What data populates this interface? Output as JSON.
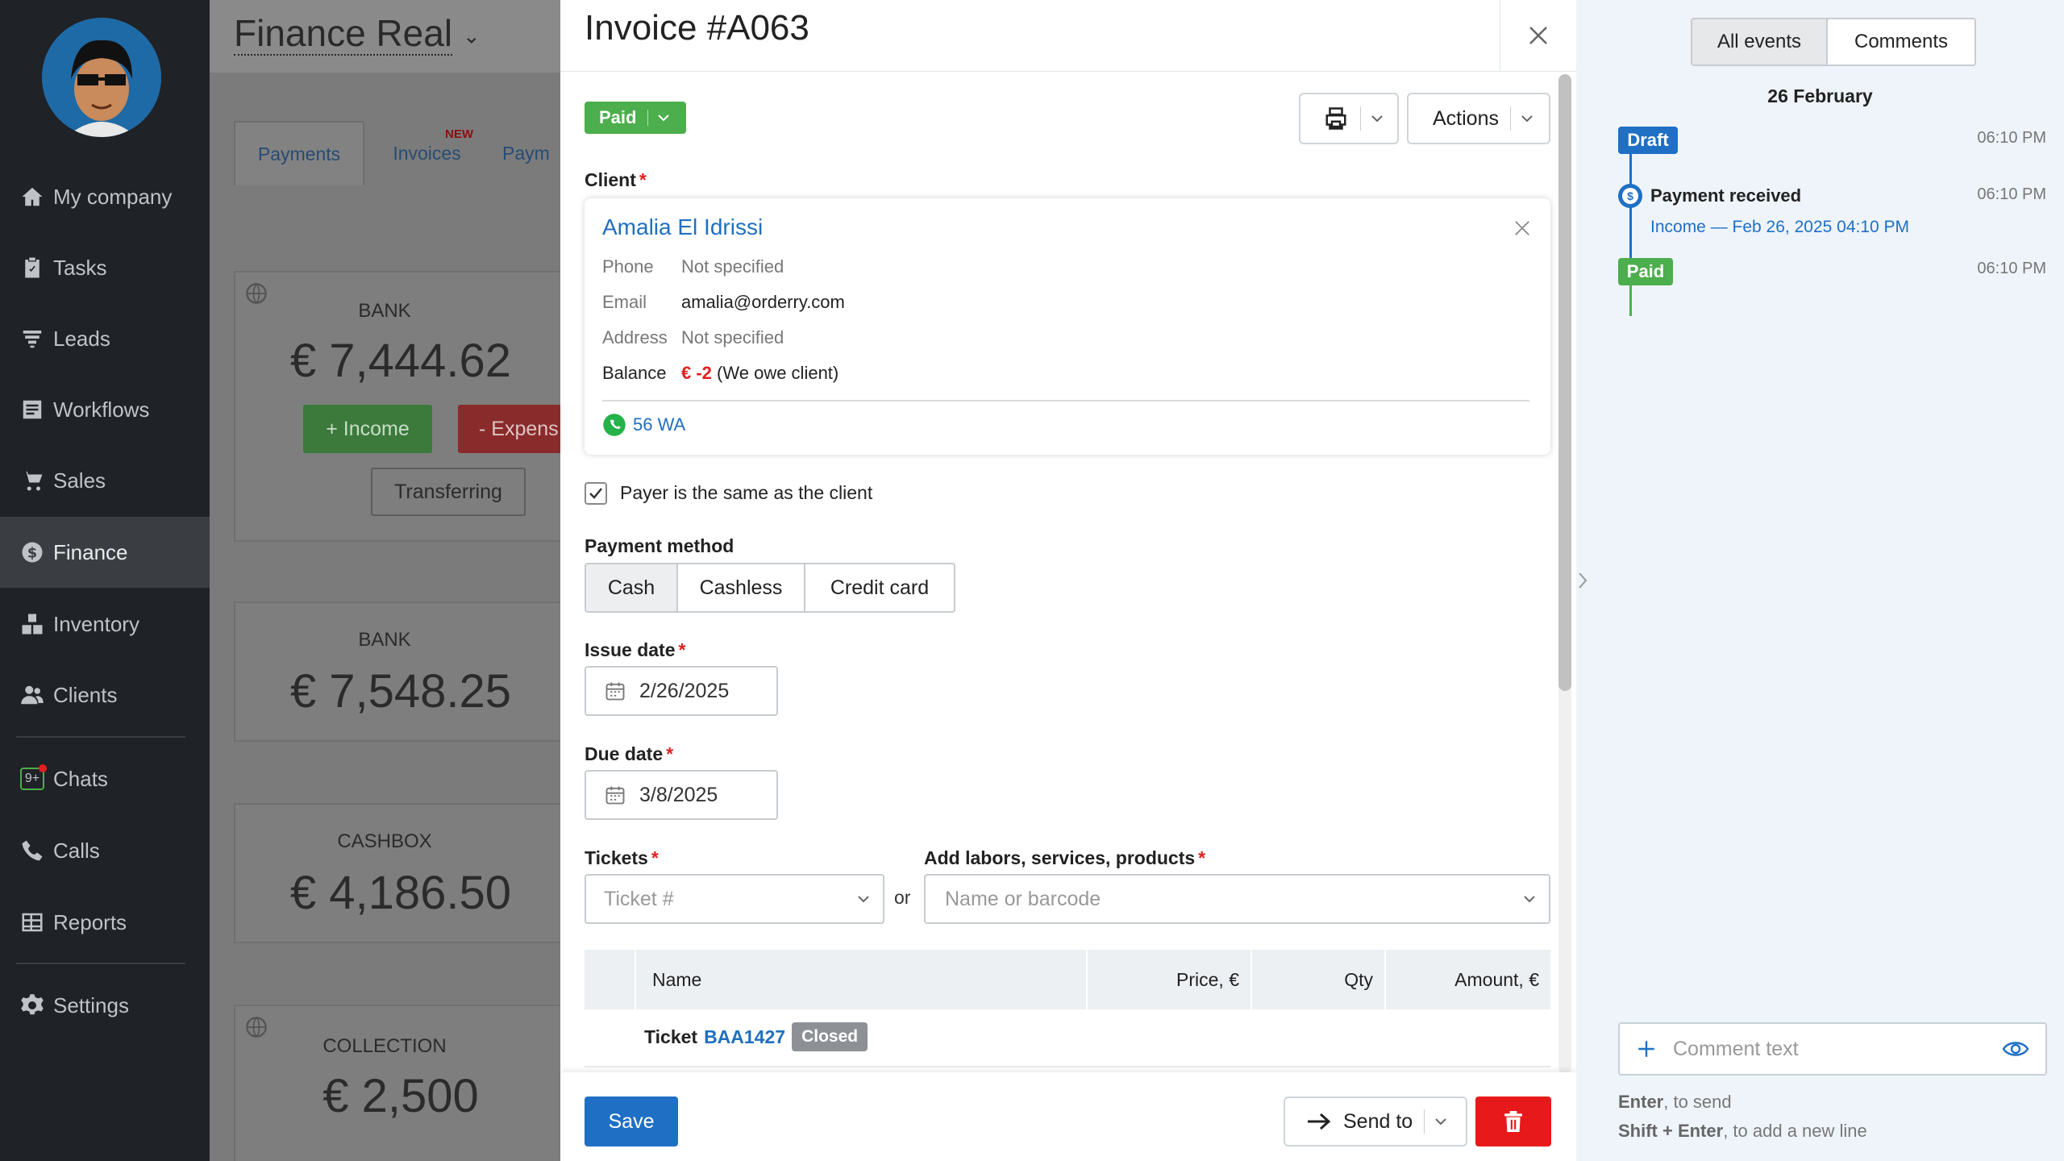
{
  "sidebar": {
    "items": [
      {
        "label": "My company",
        "icon": "home-icon"
      },
      {
        "label": "Tasks",
        "icon": "clipboard-icon"
      },
      {
        "label": "Leads",
        "icon": "filter-icon"
      },
      {
        "label": "Workflows",
        "icon": "list-icon"
      },
      {
        "label": "Sales",
        "icon": "cart-icon"
      },
      {
        "label": "Finance",
        "icon": "dollar-icon"
      },
      {
        "label": "Inventory",
        "icon": "boxes-icon"
      },
      {
        "label": "Clients",
        "icon": "users-icon"
      },
      {
        "label": "Chats",
        "icon": "chat-icon"
      },
      {
        "label": "Calls",
        "icon": "phone-icon"
      },
      {
        "label": "Reports",
        "icon": "table-icon"
      },
      {
        "label": "Settings",
        "icon": "gear-icon"
      }
    ],
    "chats_badge": "9+"
  },
  "background": {
    "title": "Finance Real",
    "tabs": {
      "payments": "Payments",
      "invoices": "Invoices",
      "new_badge": "NEW",
      "more": "Paym"
    },
    "cards": [
      {
        "label": "BANK",
        "amount": "€ 7,444.62"
      },
      {
        "label": "BANK",
        "amount": "€ 7,548.25"
      },
      {
        "label": "CASHBOX",
        "amount": "€ 4,186.50"
      },
      {
        "label": "COLLECTION",
        "amount": "€ 2,500"
      }
    ],
    "buttons": {
      "income": "+ Income",
      "expense": "- Expens",
      "transferring": "Transferring"
    }
  },
  "modal": {
    "title": "Invoice #A063",
    "status": "Paid",
    "actions_label": "Actions",
    "client_label": "Client",
    "client": {
      "name": "Amalia El Idrissi",
      "phone_label": "Phone",
      "phone": "Not specified",
      "email_label": "Email",
      "email": "amalia@orderry.com",
      "address_label": "Address",
      "address": "Not specified",
      "balance_label": "Balance",
      "balance_value": "€ -2",
      "balance_note": "(We owe client)",
      "whatsapp": "56 WA"
    },
    "payer_same": "Payer is the same as the client",
    "payer_same_checked": true,
    "payment_method_label": "Payment method",
    "payment_methods": [
      "Cash",
      "Cashless",
      "Credit card"
    ],
    "payment_method_selected": "Cash",
    "issue_date_label": "Issue date",
    "issue_date": "2/26/2025",
    "due_date_label": "Due date",
    "due_date": "3/8/2025",
    "tickets_label": "Tickets",
    "tickets_placeholder": "Ticket #",
    "or_text": "or",
    "add_items_label": "Add labors, services, products",
    "add_items_placeholder": "Name or barcode",
    "table": {
      "columns": [
        "Name",
        "Price, €",
        "Qty",
        "Amount, €"
      ],
      "ticket_row": {
        "prefix": "Ticket",
        "id": "BAA1427",
        "status": "Closed"
      }
    },
    "footer": {
      "save": "Save",
      "send_to": "Send to"
    }
  },
  "right_panel": {
    "tabs": [
      "All events",
      "Comments"
    ],
    "date_heading": "26 February",
    "events": [
      {
        "tag": "Draft",
        "time": "06:10 PM",
        "color": "#1f6fc5"
      },
      {
        "title": "Payment received",
        "link": "Income — Feb 26, 2025 04:10 PM",
        "time": "06:10 PM"
      },
      {
        "tag": "Paid",
        "time": "06:10 PM",
        "color": "#4cae4c"
      }
    ],
    "comment_placeholder": "Comment text",
    "hint1_key": "Enter",
    "hint1_text": ", to send",
    "hint2_key": "Shift + Enter",
    "hint2_text": ", to add a new line"
  }
}
